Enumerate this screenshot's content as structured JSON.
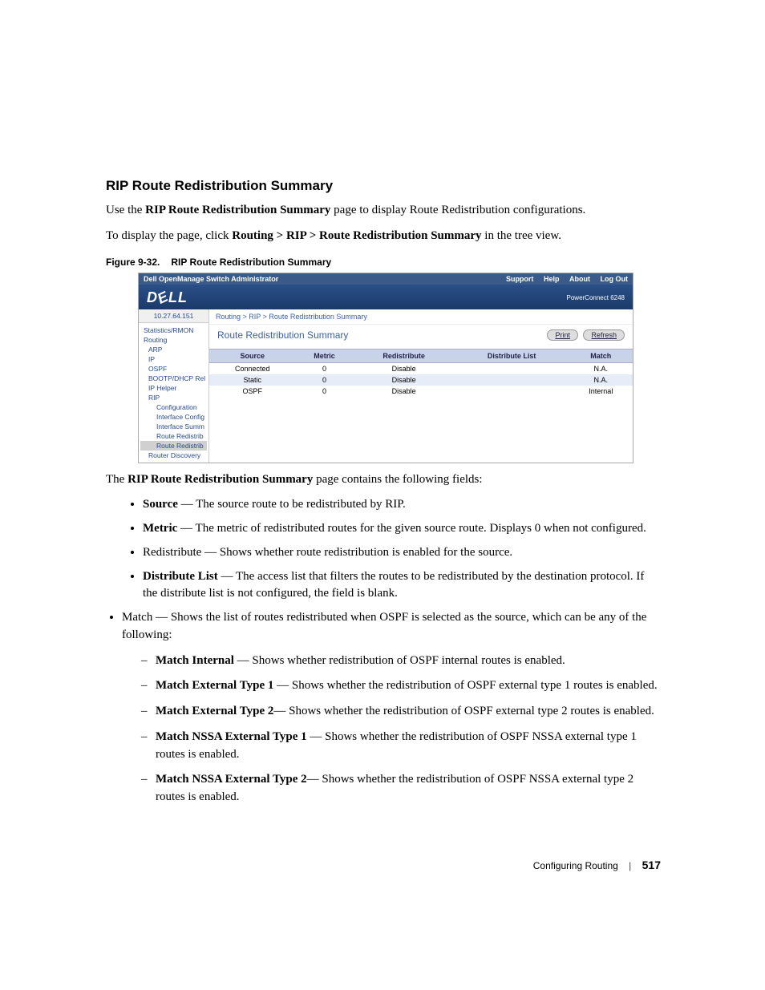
{
  "section": {
    "heading": "RIP Route Redistribution Summary"
  },
  "intro1a": "Use the ",
  "intro1b": "RIP Route Redistribution Summary",
  "intro1c": " page to display Route Redistribution configurations.",
  "intro2a": "To display the page, click ",
  "intro2b": "Routing > RIP > Route Redistribution Summary",
  "intro2c": " in the tree view.",
  "figcap": {
    "label": "Figure 9-32.",
    "title": "RIP Route Redistribution Summary"
  },
  "ss": {
    "app": "Dell OpenManage Switch Administrator",
    "nav": {
      "support": "Support",
      "help": "Help",
      "about": "About",
      "logout": "Log Out"
    },
    "product": "PowerConnect 6248",
    "ip": "10.27.64.151",
    "breadcrumb": "Routing > RIP > Route Redistribution Summary",
    "panel_title": "Route Redistribution Summary",
    "buttons": {
      "print": "Print",
      "refresh": "Refresh"
    },
    "tree": {
      "n0": "Statistics/RMON",
      "n1": "Routing",
      "n2": "ARP",
      "n3": "IP",
      "n4": "OSPF",
      "n5": "BOOTP/DHCP Rel",
      "n6": "IP Helper",
      "n7": "RIP",
      "s1": "Configuration",
      "s2": "Interface Config",
      "s3": "Interface Summ",
      "s4": "Route Redistrib",
      "s5": "Route Redistrib",
      "n8": "Router Discovery"
    },
    "table": {
      "h": {
        "source": "Source",
        "metric": "Metric",
        "redist": "Redistribute",
        "dist": "Distribute List",
        "match": "Match"
      },
      "r1": {
        "source": "Connected",
        "metric": "0",
        "redist": "Disable",
        "dist": "",
        "match": "N.A."
      },
      "r2": {
        "source": "Static",
        "metric": "0",
        "redist": "Disable",
        "dist": "",
        "match": "N.A."
      },
      "r3": {
        "source": "OSPF",
        "metric": "0",
        "redist": "Disable",
        "dist": "",
        "match": "Internal"
      }
    }
  },
  "desc1a": "The ",
  "desc1b": "RIP Route Redistribution Summary",
  "desc1c": " page contains the following fields:",
  "fields": {
    "source": {
      "b": "Source",
      "t": " — The source route to be redistributed by RIP."
    },
    "metric": {
      "b": "Metric",
      "t": " — The metric of redistributed routes for the given source route. Displays 0 when not configured."
    },
    "redist": {
      "t": "Redistribute — Shows whether route redistribution is enabled for the source."
    },
    "dist": {
      "b": "Distribute List",
      "t": " — The access list that filters the routes to be redistributed by the destination protocol. If the distribute list is not configured, the field is blank."
    },
    "match": {
      "t": "Match — Shows the list of routes redistributed when OSPF is selected as the source, which can be any of the following:"
    },
    "sub": {
      "a": {
        "b": "Match Internal",
        "t": " — Shows whether redistribution of OSPF internal routes is enabled."
      },
      "b": {
        "b": "Match External Type 1",
        "t": " — Shows whether the redistribution of OSPF external type 1 routes is enabled."
      },
      "c": {
        "b": "Match External Type 2",
        "t": "— Shows whether the redistribution of OSPF external type 2 routes is enabled."
      },
      "d": {
        "b": "Match NSSA External Type 1",
        "t": " — Shows whether the redistribution of OSPF NSSA external type 1 routes is enabled."
      },
      "e": {
        "b": "Match NSSA External Type 2",
        "t": "— Shows whether the redistribution of OSPF NSSA external type 2 routes is enabled."
      }
    }
  },
  "footer": {
    "section": "Configuring Routing",
    "page": "517"
  }
}
